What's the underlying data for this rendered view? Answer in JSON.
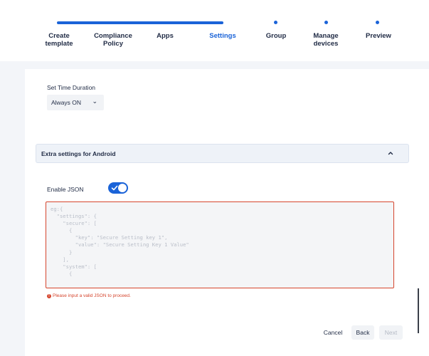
{
  "stepper": {
    "steps": [
      {
        "label": "Create\ntemplate"
      },
      {
        "label": "Compliance\nPolicy"
      },
      {
        "label": "Apps"
      },
      {
        "label": "Settings"
      },
      {
        "label": "Group"
      },
      {
        "label": "Manage\ndevices"
      },
      {
        "label": "Preview"
      }
    ],
    "active_step": "Settings",
    "accent": "#1a63d8"
  },
  "time_duration": {
    "label": "Set Time Duration",
    "selected": "Always ON"
  },
  "accordion": {
    "title": "Extra settings for Android",
    "expanded": true
  },
  "json_settings": {
    "toggle_label": "Enable JSON",
    "enabled": true,
    "placeholder": "eg:{\n  \"settings\": {\n    \"secure\": [\n      {\n        \"key\": \"Secure Setting key 1\",\n        \"value\": \"Secure Setting Key 1 Value\"\n      }\n    ],\n    \"system\": [\n      {",
    "error": "Please input a valid JSON to proceed.",
    "error_color": "#d5452d"
  },
  "footer": {
    "cancel_label": "Cancel",
    "back_label": "Back",
    "next_label": "Next"
  }
}
